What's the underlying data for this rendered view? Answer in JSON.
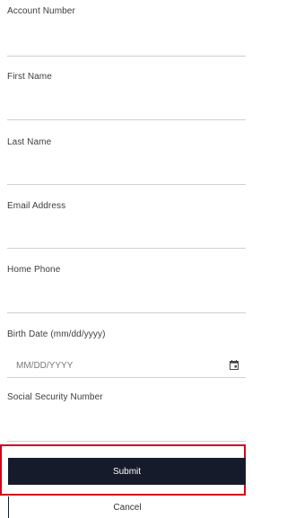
{
  "form": {
    "account_number": {
      "label": "Account Number",
      "value": "",
      "placeholder": ""
    },
    "first_name": {
      "label": "First Name",
      "value": "",
      "placeholder": ""
    },
    "last_name": {
      "label": "Last Name",
      "value": "",
      "placeholder": ""
    },
    "email": {
      "label": "Email Address",
      "value": "",
      "placeholder": ""
    },
    "home_phone": {
      "label": "Home Phone",
      "value": "",
      "placeholder": ""
    },
    "birth_date": {
      "label": "Birth Date (mm/dd/yyyy)",
      "value": "",
      "placeholder": "MM/DD/YYYY",
      "icon": "calendar-icon"
    },
    "ssn": {
      "label": "Social Security Number",
      "value": "",
      "placeholder": ""
    }
  },
  "actions": {
    "submit_label": "Submit",
    "cancel_label": "Cancel"
  },
  "colors": {
    "submit_bg": "#161b2c",
    "highlight": "#d0021b",
    "divider": "#cfcfcf"
  }
}
